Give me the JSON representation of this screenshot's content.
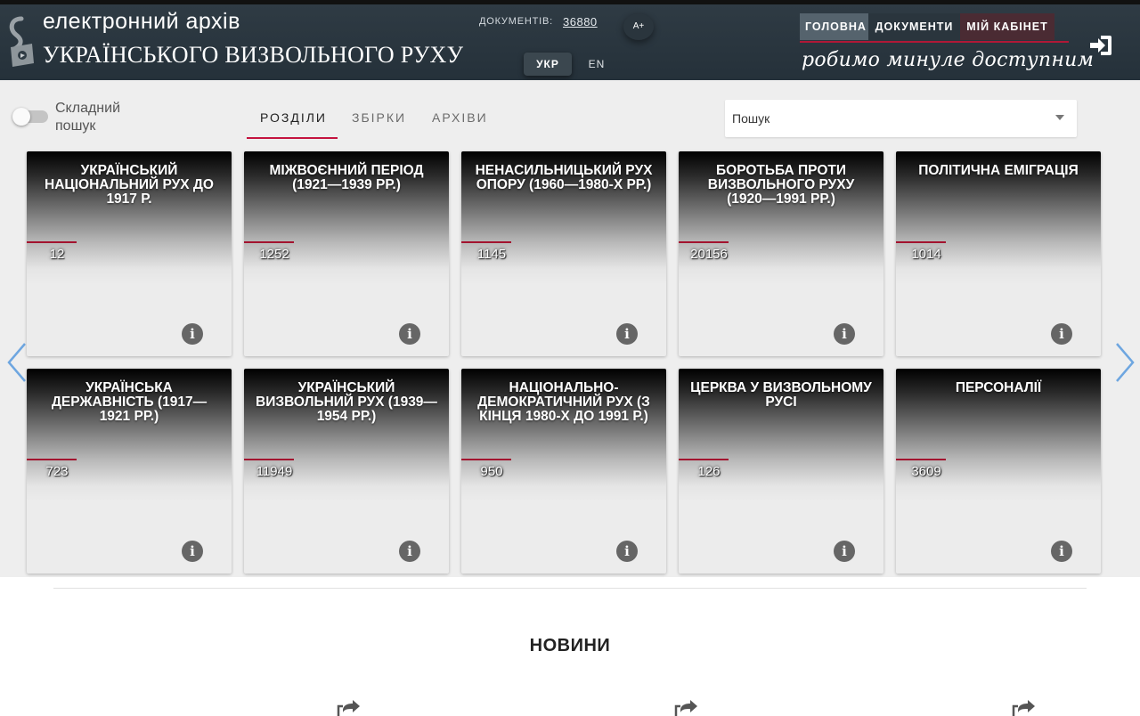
{
  "header": {
    "title_line1": "електронний архів",
    "title_line2": "УКРАЇНСЬКОГО ВИЗВОЛЬНОГО РУХУ",
    "doc_count_label": "ДОКУМЕНТІВ:",
    "doc_count_value": "36880",
    "font_size_button": "A+",
    "languages": {
      "ukr": "УКР",
      "en": "EN"
    },
    "nav": {
      "home": "ГОЛОВНА",
      "documents": "ДОКУМЕНТИ",
      "cabinet": "МІЙ КАБІНЕТ"
    },
    "slogan": "робимо минуле доступним",
    "accent_color": "#b01836"
  },
  "search_bar": {
    "advanced_toggle_label": "Складний пошук",
    "tabs": [
      "РОЗДІЛИ",
      "ЗБІРКИ",
      "АРХІВИ"
    ],
    "active_tab": "РОЗДІЛИ",
    "search_placeholder": "Пошук"
  },
  "cards": [
    {
      "title": "Український національний рух до 1917 р.",
      "count": "12"
    },
    {
      "title": "Міжвоєнний період (1921—1939 рр.)",
      "count": "1252"
    },
    {
      "title": "Ненасильницький рух опору (1960—1980-х рр.)",
      "count": "1145"
    },
    {
      "title": "Боротьба проти визвольного руху (1920—1991 рр.)",
      "count": "20156"
    },
    {
      "title": "Політична еміграція",
      "count": "1014"
    },
    {
      "title": "Українська державність (1917—1921 рр.)",
      "count": "723"
    },
    {
      "title": "Український визвольний рух (1939—1954 рр.)",
      "count": "11949"
    },
    {
      "title": "Національно-демократичний рух (з кінця 1980-х до 1991 р.)",
      "count": "950"
    },
    {
      "title": "Церква у визвольному русі",
      "count": "126"
    },
    {
      "title": "Персоналії",
      "count": "3609"
    }
  ],
  "news": {
    "title": "НОВИНИ"
  },
  "icons": {
    "logo": "archive-logo-icon",
    "login": "login-icon",
    "info": "info-icon",
    "prev": "chevron-left-icon",
    "next": "chevron-right-icon",
    "share": "share-icon"
  }
}
